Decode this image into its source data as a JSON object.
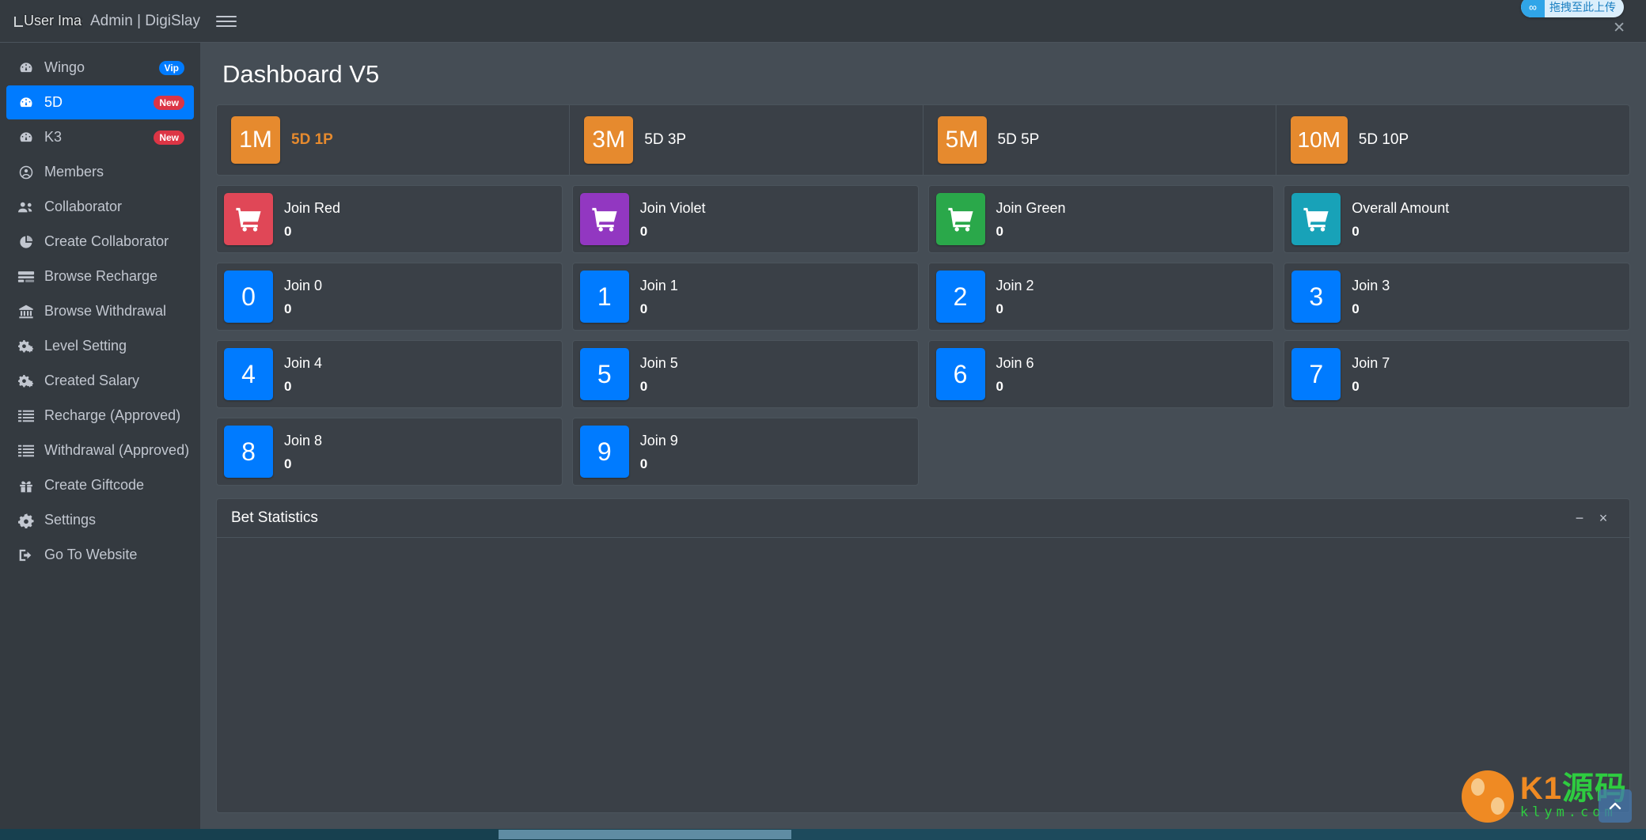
{
  "brand": {
    "user_image_alt": "User Image",
    "title": "Admin | DigiSlay"
  },
  "sidebar": {
    "items": [
      {
        "label": "Wingo",
        "icon": "dashboard-icon",
        "badge": "Vip",
        "badge_type": "vip",
        "active": false
      },
      {
        "label": "5D",
        "icon": "dashboard-icon",
        "badge": "New",
        "badge_type": "new",
        "active": true
      },
      {
        "label": "K3",
        "icon": "dashboard-icon",
        "badge": "New",
        "badge_type": "new",
        "active": false
      },
      {
        "label": "Members",
        "icon": "user-circle-icon",
        "badge": "",
        "badge_type": "",
        "active": false
      },
      {
        "label": "Collaborator",
        "icon": "users-icon",
        "badge": "",
        "badge_type": "",
        "active": false
      },
      {
        "label": "Create Collaborator",
        "icon": "pie-chart-icon",
        "badge": "",
        "badge_type": "",
        "active": false
      },
      {
        "label": "Browse Recharge",
        "icon": "credit-card-icon",
        "badge": "",
        "badge_type": "",
        "active": false
      },
      {
        "label": "Browse Withdrawal",
        "icon": "bank-icon",
        "badge": "",
        "badge_type": "",
        "active": false
      },
      {
        "label": "Level Setting",
        "icon": "cogs-icon",
        "badge": "",
        "badge_type": "",
        "active": false
      },
      {
        "label": "Created Salary",
        "icon": "cogs-icon",
        "badge": "",
        "badge_type": "",
        "active": false
      },
      {
        "label": "Recharge (Approved)",
        "icon": "list-icon",
        "badge": "",
        "badge_type": "",
        "active": false
      },
      {
        "label": "Withdrawal (Approved)",
        "icon": "list-icon",
        "badge": "",
        "badge_type": "",
        "active": false
      },
      {
        "label": "Create Giftcode",
        "icon": "gift-icon",
        "badge": "",
        "badge_type": "",
        "active": false
      },
      {
        "label": "Settings",
        "icon": "gear-icon",
        "badge": "",
        "badge_type": "",
        "active": false
      },
      {
        "label": "Go To Website",
        "icon": "sign-out-icon",
        "badge": "",
        "badge_type": "",
        "active": false
      }
    ]
  },
  "topbar": {
    "menu_icon": "hamburger-icon"
  },
  "page": {
    "title": "Dashboard V5"
  },
  "periods": [
    {
      "chip": "1M",
      "label": "5D 1P",
      "active": true
    },
    {
      "chip": "3M",
      "label": "5D 3P",
      "active": false
    },
    {
      "chip": "5M",
      "label": "5D 5P",
      "active": false
    },
    {
      "chip": "10M",
      "label": "5D 10P",
      "active": false
    }
  ],
  "color_cards": [
    {
      "label": "Join Red",
      "value": "0",
      "color": "#e04757",
      "icon": "cart-icon"
    },
    {
      "label": "Join Violet",
      "value": "0",
      "color": "#9237c1",
      "icon": "cart-icon"
    },
    {
      "label": "Join Green",
      "value": "0",
      "color": "#2aa84a",
      "icon": "cart-icon"
    },
    {
      "label": "Overall Amount",
      "value": "0",
      "color": "#18a2b8",
      "icon": "cart-icon"
    }
  ],
  "number_cards": [
    {
      "chip": "0",
      "label": "Join 0",
      "value": "0",
      "color": "#007bff"
    },
    {
      "chip": "1",
      "label": "Join 1",
      "value": "0",
      "color": "#007bff"
    },
    {
      "chip": "2",
      "label": "Join 2",
      "value": "0",
      "color": "#007bff"
    },
    {
      "chip": "3",
      "label": "Join 3",
      "value": "0",
      "color": "#007bff"
    },
    {
      "chip": "4",
      "label": "Join 4",
      "value": "0",
      "color": "#007bff"
    },
    {
      "chip": "5",
      "label": "Join 5",
      "value": "0",
      "color": "#007bff"
    },
    {
      "chip": "6",
      "label": "Join 6",
      "value": "0",
      "color": "#007bff"
    },
    {
      "chip": "7",
      "label": "Join 7",
      "value": "0",
      "color": "#007bff"
    },
    {
      "chip": "8",
      "label": "Join 8",
      "value": "0",
      "color": "#007bff"
    },
    {
      "chip": "9",
      "label": "Join 9",
      "value": "0",
      "color": "#007bff"
    }
  ],
  "bet_panel": {
    "title": "Bet Statistics",
    "minimize_label": "−",
    "close_label": "×"
  },
  "upload_badge": {
    "text": "拖拽至此上传",
    "icon": "infinity-icon",
    "close_label": "✕"
  },
  "watermark": {
    "main_prefix": "K1",
    "main_suffix": "源码",
    "sub": "klym.com"
  },
  "to_top": {
    "icon": "chevron-up-icon",
    "label": "⌃"
  },
  "colors": {
    "accent": "#007bff",
    "orange": "#e68a2e",
    "sidebar_bg": "#343a40",
    "card_bg": "#3a4047",
    "page_bg": "#454d55"
  }
}
